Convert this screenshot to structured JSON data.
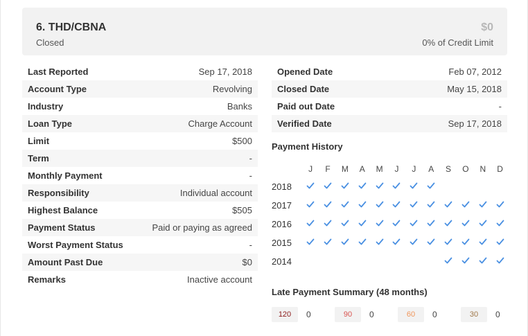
{
  "header": {
    "title": "6. THD/CBNA",
    "status": "Closed",
    "amount": "$0",
    "credit_limit_text": "0% of Credit Limit"
  },
  "left_rows": [
    {
      "key": "Last Reported",
      "value": "Sep 17, 2018"
    },
    {
      "key": "Account Type",
      "value": "Revolving"
    },
    {
      "key": "Industry",
      "value": "Banks"
    },
    {
      "key": "Loan Type",
      "value": "Charge Account"
    },
    {
      "key": "Limit",
      "value": "$500"
    },
    {
      "key": "Term",
      "value": "-"
    },
    {
      "key": "Monthly Payment",
      "value": "-"
    },
    {
      "key": "Responsibility",
      "value": "Individual account"
    },
    {
      "key": "Highest Balance",
      "value": "$505"
    },
    {
      "key": "Payment Status",
      "value": "Paid or paying as agreed"
    },
    {
      "key": "Worst Payment Status",
      "value": "-"
    },
    {
      "key": "Amount Past Due",
      "value": "$0"
    },
    {
      "key": "Remarks",
      "value": "Inactive account"
    }
  ],
  "right_rows": [
    {
      "key": "Opened Date",
      "value": "Feb 07, 2012"
    },
    {
      "key": "Closed Date",
      "value": "May 15, 2018"
    },
    {
      "key": "Paid out Date",
      "value": "-"
    },
    {
      "key": "Verified Date",
      "value": "Sep 17, 2018"
    }
  ],
  "payment_history": {
    "title": "Payment History",
    "months": [
      "J",
      "F",
      "M",
      "A",
      "M",
      "J",
      "J",
      "A",
      "S",
      "O",
      "N",
      "D"
    ],
    "check_color": "#4a90e2",
    "years": [
      {
        "year": "2018",
        "paid": [
          true,
          true,
          true,
          true,
          true,
          true,
          true,
          true,
          false,
          false,
          false,
          false
        ]
      },
      {
        "year": "2017",
        "paid": [
          true,
          true,
          true,
          true,
          true,
          true,
          true,
          true,
          true,
          true,
          true,
          true
        ]
      },
      {
        "year": "2016",
        "paid": [
          true,
          true,
          true,
          true,
          true,
          true,
          true,
          true,
          true,
          true,
          true,
          true
        ]
      },
      {
        "year": "2015",
        "paid": [
          true,
          true,
          true,
          true,
          true,
          true,
          true,
          true,
          true,
          true,
          true,
          true
        ]
      },
      {
        "year": "2014",
        "paid": [
          false,
          false,
          false,
          false,
          false,
          false,
          false,
          false,
          true,
          true,
          true,
          true
        ]
      }
    ]
  },
  "late_summary": {
    "title": "Late Payment Summary (48 months)",
    "items": [
      {
        "days": "120",
        "count": "0",
        "color": "#8b1a1a"
      },
      {
        "days": "90",
        "count": "0",
        "color": "#d9534f"
      },
      {
        "days": "60",
        "count": "0",
        "color": "#f0965a"
      },
      {
        "days": "30",
        "count": "0",
        "color": "#a0784a"
      }
    ]
  }
}
